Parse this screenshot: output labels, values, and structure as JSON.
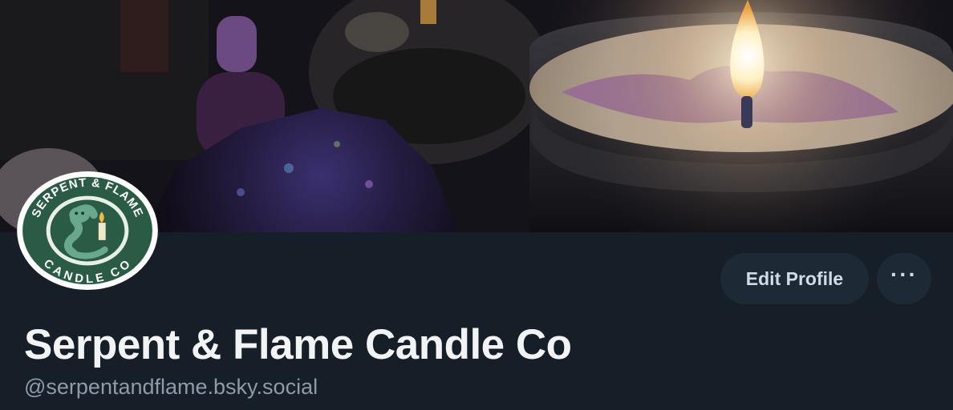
{
  "banner": {
    "image_description_icon": "candle-banner-image"
  },
  "avatar": {
    "logo_text_top": "SERPENT & FLAME",
    "logo_text_bottom": "CANDLE CO",
    "colors": {
      "ring": "#2a5b45",
      "inner": "#e9efe7",
      "snake": "#4d8a73"
    }
  },
  "actions": {
    "edit_profile_label": "Edit Profile",
    "more_label": "···"
  },
  "profile": {
    "display_name": "Serpent & Flame Candle Co",
    "handle": "@serpentandflame.bsky.social"
  },
  "colors": {
    "background": "#161e27",
    "button_bg": "#1e2936",
    "name_text": "#f1f3f5",
    "handle_text": "#8e9bab"
  }
}
